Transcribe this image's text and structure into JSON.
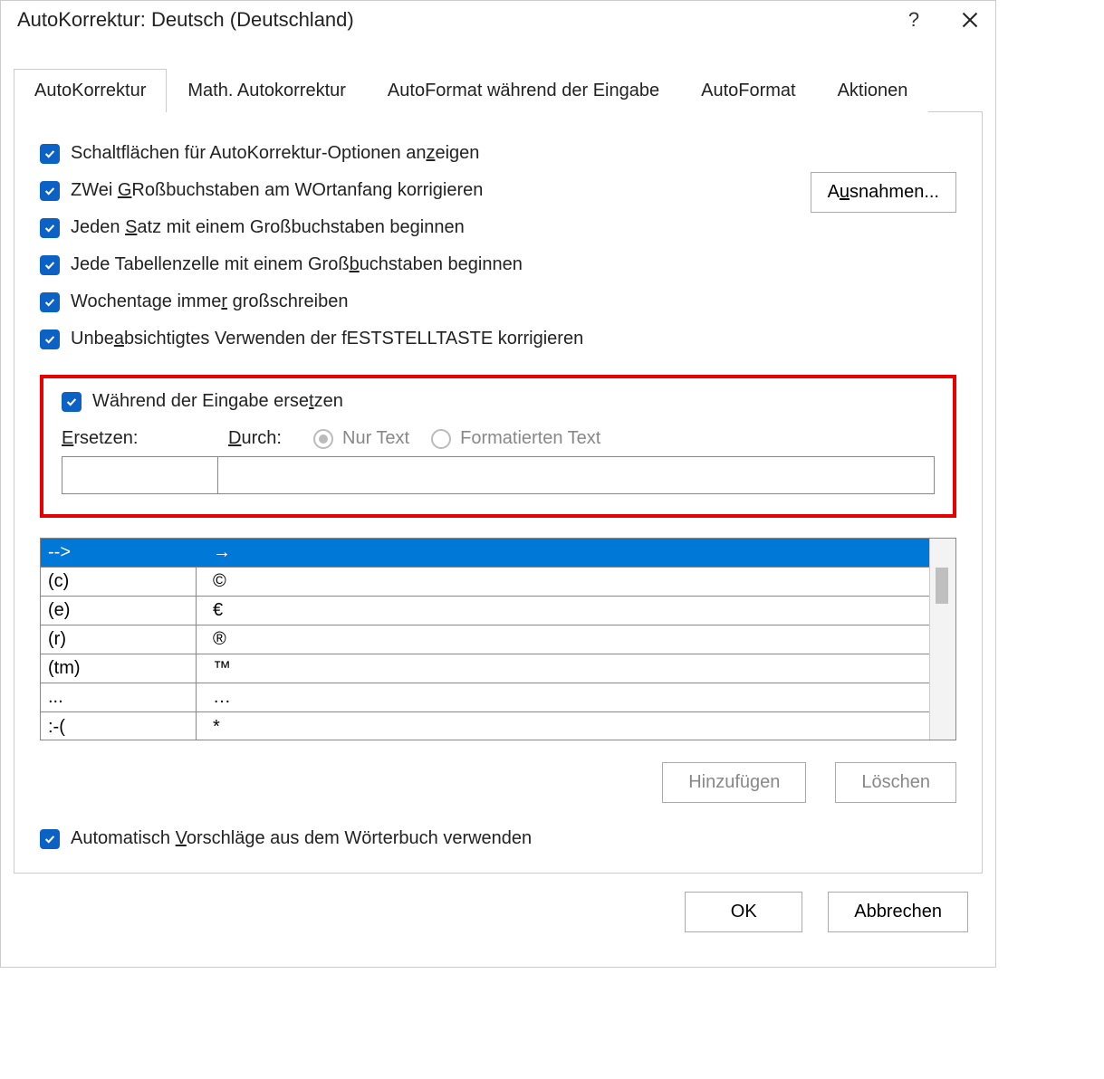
{
  "title": "AutoKorrektur: Deutsch (Deutschland)",
  "help": "?",
  "tabs": {
    "autokorrektur": "AutoKorrektur",
    "math": "Math. Autokorrektur",
    "autoformat_typing": "AutoFormat während der Eingabe",
    "autoformat": "AutoFormat",
    "actions": "Aktionen"
  },
  "opts": {
    "show_buttons_pre": "Schaltflächen für AutoKorrektur-Optionen an",
    "show_buttons_u": "z",
    "show_buttons_post": "eigen",
    "two_caps_pre": "ZWei ",
    "two_caps_u": "G",
    "two_caps_post": "Roßbuchstaben am WOrtanfang korrigieren",
    "sentence_pre": "Jeden ",
    "sentence_u": "S",
    "sentence_post": "atz mit einem Großbuchstaben beginnen",
    "cell_pre": "Jede Tabellenzelle mit einem Groß",
    "cell_u": "b",
    "cell_post": "uchstaben beginnen",
    "weekday_pre": "Wochentage imme",
    "weekday_u": "r",
    "weekday_post": " großschreiben",
    "caps_pre": "Unbe",
    "caps_u": "a",
    "caps_post": "bsichtigtes Verwenden der fESTSTELLTASTE korrigieren",
    "exceptions_pre": "A",
    "exceptions_u": "u",
    "exceptions_post": "snahmen..."
  },
  "replace": {
    "header_pre": "Während der Eingabe erse",
    "header_u": "t",
    "header_post": "zen",
    "replace_u": "E",
    "replace_post": "rsetzen:",
    "with_u": "D",
    "with_post": "urch:",
    "plain": "Nur Text",
    "formatted": "Formatierten Text",
    "in_replace": "",
    "in_with": ""
  },
  "table": [
    {
      "from": "-->",
      "to": "→"
    },
    {
      "from": "(c)",
      "to": "©"
    },
    {
      "from": "(e)",
      "to": "€"
    },
    {
      "from": "(r)",
      "to": "®"
    },
    {
      "from": "(tm)",
      "to": "™"
    },
    {
      "from": "...",
      "to": "…"
    },
    {
      "from": ":-(",
      "to": "*"
    }
  ],
  "buttons": {
    "add": "Hinzufügen",
    "delete": "Löschen",
    "dict_pre": "Automatisch ",
    "dict_u": "V",
    "dict_post": "orschläge aus dem Wörterbuch verwenden",
    "ok": "OK",
    "cancel": "Abbrechen"
  }
}
